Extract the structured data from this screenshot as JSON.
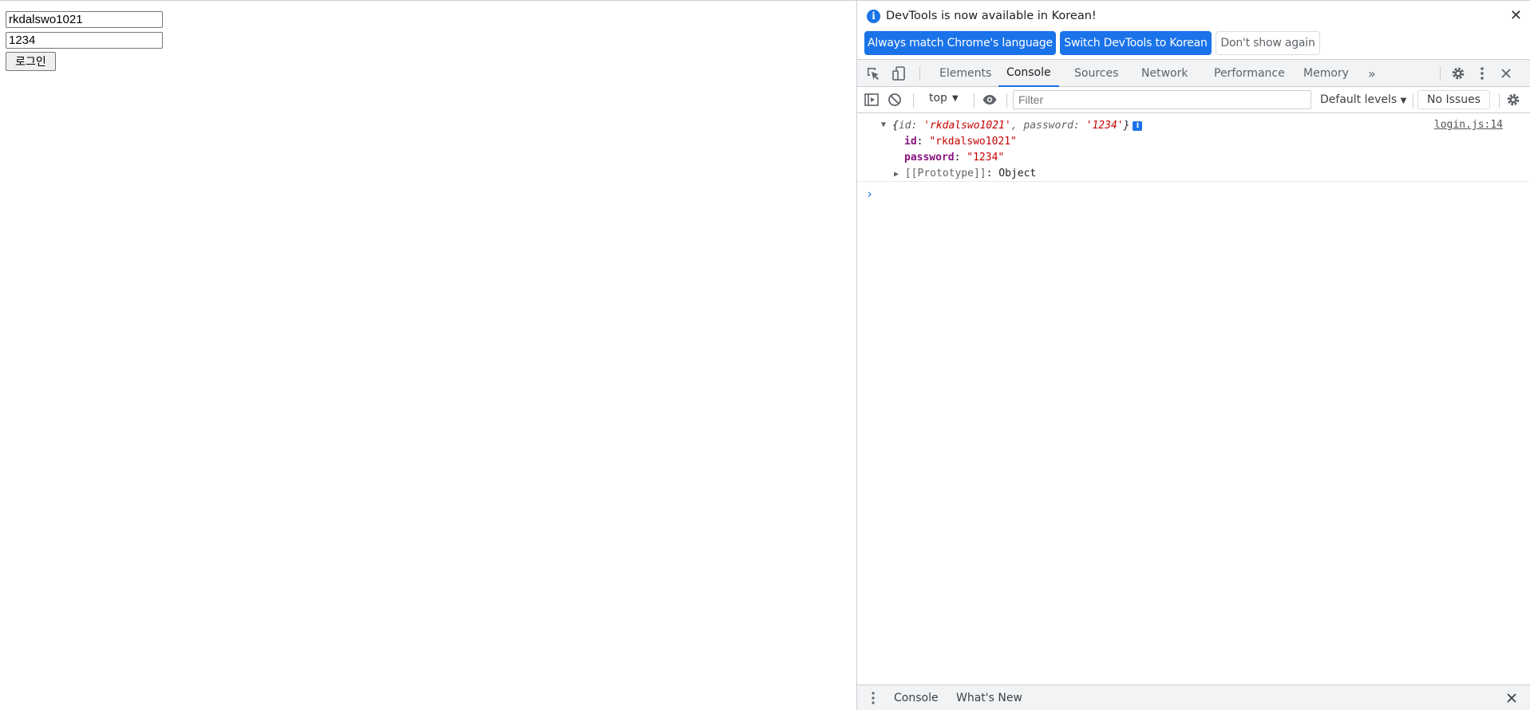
{
  "page": {
    "id_value": "rkdalswo1021",
    "pw_value": "1234",
    "login_label": "로그인"
  },
  "infobar": {
    "message": "DevTools is now available in Korean!",
    "buttons": [
      "Always match Chrome's language",
      "Switch DevTools to Korean",
      "Don't show again"
    ],
    "close_icon": "close-icon"
  },
  "tabs": [
    "Elements",
    "Console",
    "Sources",
    "Network",
    "Performance",
    "Memory"
  ],
  "active_tab": "Console",
  "toolbar": {
    "context": "top",
    "filter_placeholder": "Filter",
    "levels": "Default levels",
    "issues": "No Issues"
  },
  "log": {
    "preview_open": "{",
    "preview_k1": "id",
    "preview_v1": "'rkdalswo1021'",
    "preview_k2": "password",
    "preview_v2": "'1234'",
    "preview_close": "}",
    "source": "login.js:14",
    "props": [
      {
        "key": "id",
        "value": "\"rkdalswo1021\""
      },
      {
        "key": "password",
        "value": "\"1234\""
      }
    ],
    "proto_key": "[[Prototype]]",
    "proto_value": "Object"
  },
  "drawer": {
    "tabs": [
      "Console",
      "What's New"
    ]
  },
  "colors": {
    "accent": "#1a73e8",
    "string": "#c80000",
    "prop_key": "#881280"
  }
}
